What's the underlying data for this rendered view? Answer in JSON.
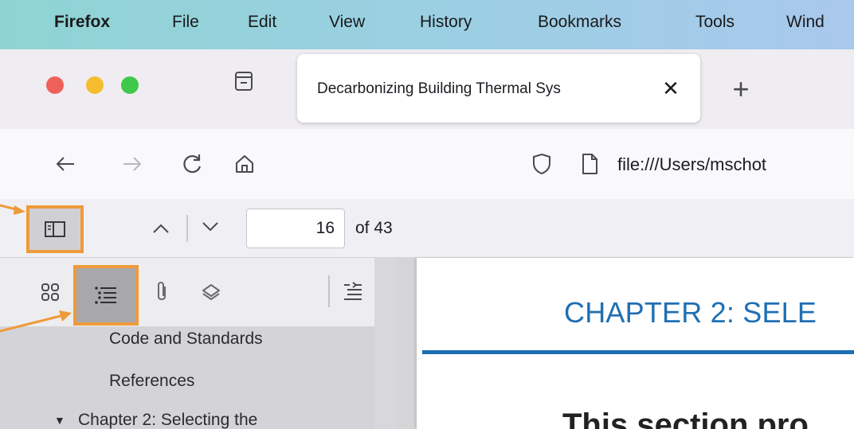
{
  "menubar": {
    "items": [
      "Firefox",
      "File",
      "Edit",
      "View",
      "History",
      "Bookmarks",
      "Tools",
      "Wind"
    ]
  },
  "window": {
    "traffic_lights": {
      "close": "#f0605a",
      "minimize": "#f5bd2e",
      "zoom": "#3fc84a"
    }
  },
  "tab": {
    "title": "Decarbonizing Building Thermal Sys",
    "close_label": "✕",
    "new_tab_label": "+"
  },
  "navbar": {
    "url": "file:///Users/mschot"
  },
  "pdf_toolbar": {
    "page_number": "16",
    "page_count_label": "of 43"
  },
  "sidebar": {
    "outline": [
      {
        "label": "Code and Standards"
      },
      {
        "label": "References"
      },
      {
        "label": "Chapter 2: Selecting the",
        "expanded": true,
        "twisty": "▼"
      }
    ]
  },
  "document": {
    "heading": "CHAPTER 2: SELE",
    "body_start": "This section pro"
  },
  "colors": {
    "highlight_border": "#ef9a3a",
    "heading_blue": "#1f6fb3"
  },
  "icons": [
    "tab-list-icon",
    "back-arrow-icon",
    "forward-arrow-icon",
    "reload-icon",
    "home-icon",
    "tracking-shield-icon",
    "page-icon",
    "sidebar-toggle-icon",
    "chevron-up-icon",
    "chevron-down-icon",
    "thumbnails-icon",
    "outline-icon",
    "attachments-icon",
    "layers-icon",
    "current-outline-item-icon"
  ]
}
